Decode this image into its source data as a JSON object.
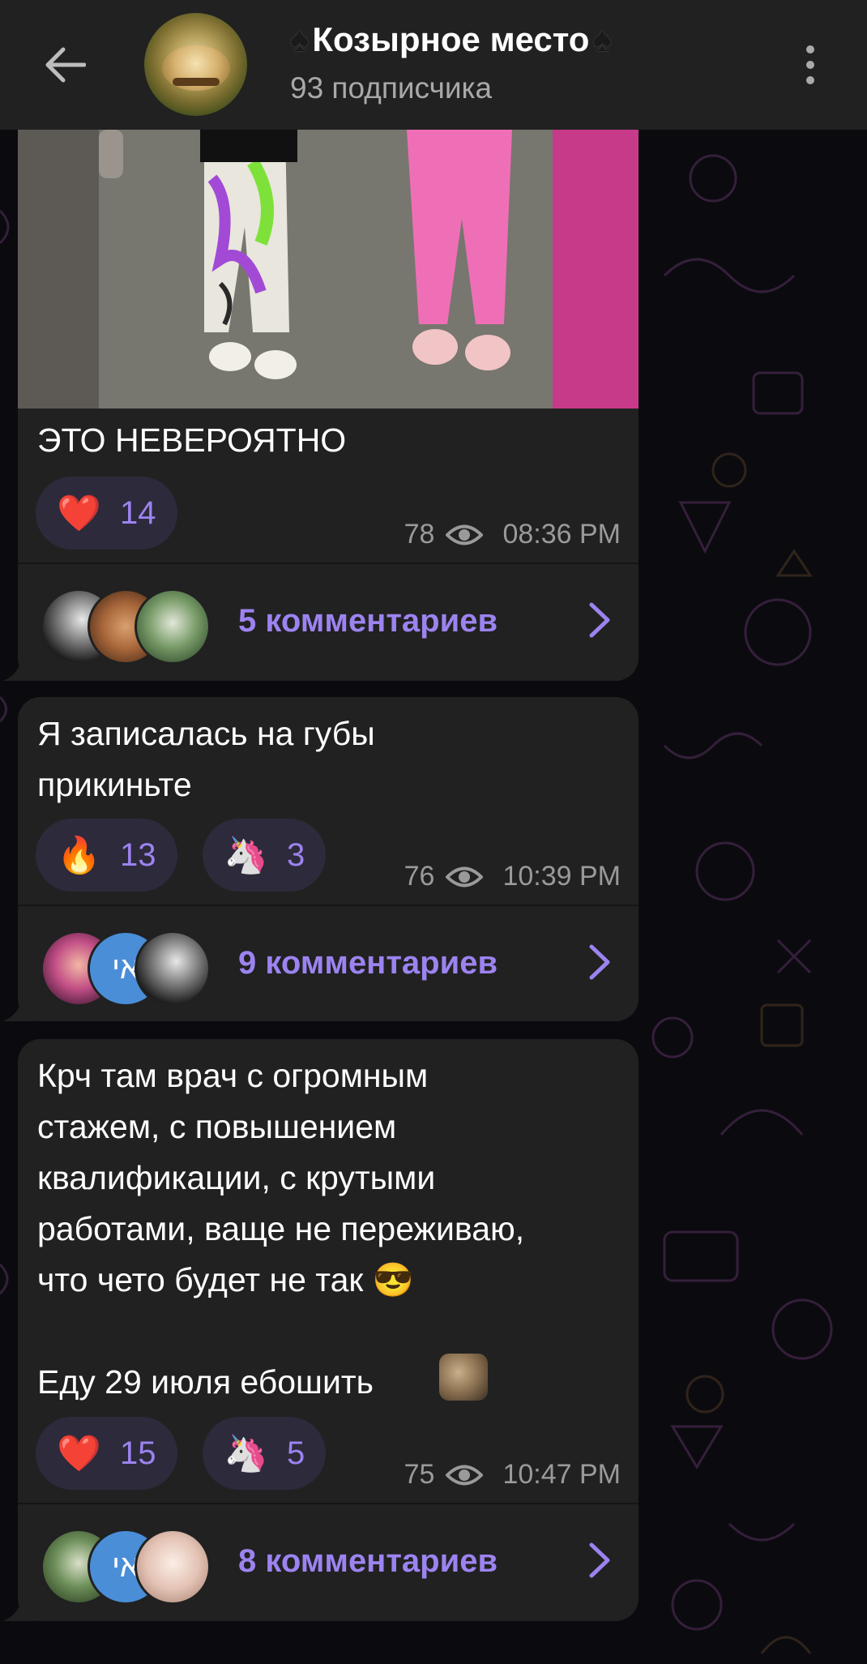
{
  "header": {
    "title": "Козырное место",
    "title_prefix_icon": "spade-icon",
    "title_suffix_icon": "spade-icon",
    "subscribers": "93 подписчика"
  },
  "messages": [
    {
      "text": "ЭТО НЕВЕРОЯТНО",
      "reactions": [
        {
          "emoji": "❤️",
          "icon": "heart-icon",
          "count": "14"
        }
      ],
      "views": "78",
      "time": "08:36 PM",
      "comments": "5 комментариев"
    },
    {
      "text": "Я записалась на губы\nприкиньте",
      "reactions": [
        {
          "emoji": "🔥",
          "icon": "fire-icon",
          "count": "13"
        },
        {
          "emoji": "🦄",
          "icon": "unicorn-icon",
          "count": "3"
        }
      ],
      "views": "76",
      "time": "10:39 PM",
      "comments": "9 комментариев"
    },
    {
      "text": "Крч там врач с огромным\nстажем, с повышением\nквалификации, с крутыми\nработами, ваще не переживаю,\nчто чето будет не так 😎\n\nЕду 29 июля ебошить",
      "reactions": [
        {
          "emoji": "❤️",
          "icon": "heart-icon",
          "count": "15"
        },
        {
          "emoji": "🦄",
          "icon": "unicorn-icon",
          "count": "5"
        }
      ],
      "views": "75",
      "time": "10:47 PM",
      "comments": "8 комментариев"
    }
  ],
  "colors": {
    "header_bg": "#212121",
    "bubble_bg": "#212121",
    "accent": "#9c83f0",
    "reaction_bg": "#2d2a3b",
    "background": "#0b0b0f"
  }
}
